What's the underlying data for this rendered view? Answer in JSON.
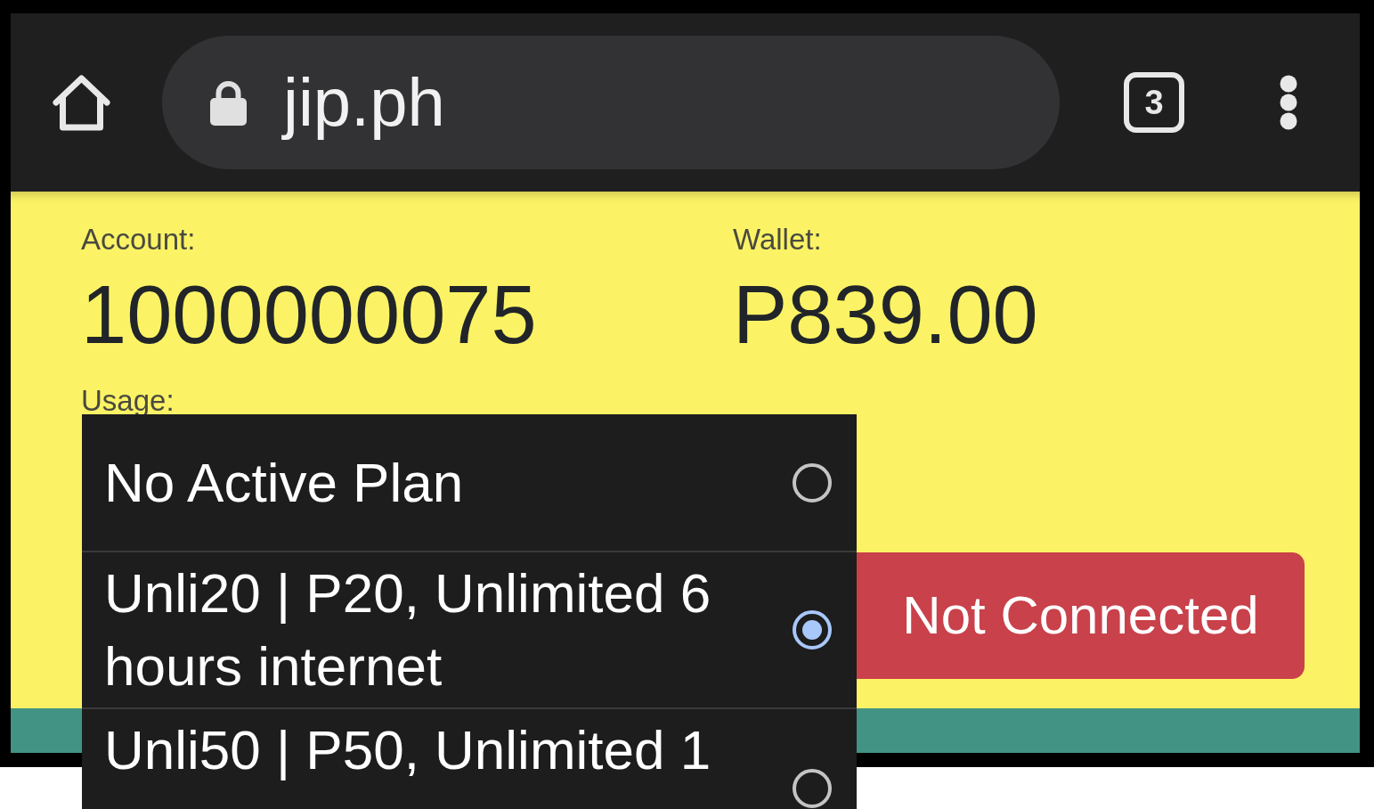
{
  "browser": {
    "url": "jip.ph",
    "tab_count": "3"
  },
  "account": {
    "label": "Account:",
    "value": "1000000075"
  },
  "wallet": {
    "label": "Wallet:",
    "value": "P839.00"
  },
  "usage": {
    "label": "Usage:"
  },
  "connection_button": {
    "label": "Not Connected",
    "connected": false
  },
  "plan_dropdown": {
    "options": [
      {
        "label": "No Active Plan",
        "selected": false
      },
      {
        "label": "Unli20 | P20, Unlimited 6 hours internet",
        "selected": true
      },
      {
        "label": "Unli50 | P50, Unlimited 1",
        "selected": false
      }
    ]
  }
}
